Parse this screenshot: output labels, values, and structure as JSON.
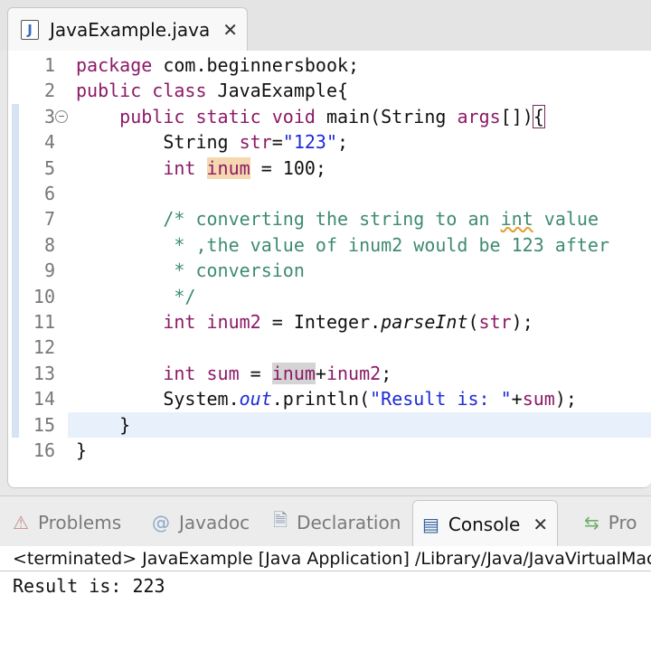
{
  "editor": {
    "tab": {
      "icon_letter": "J",
      "title": "JavaExample.java",
      "close": "✕"
    },
    "lines": [
      {
        "n": "1",
        "segs": [
          {
            "t": "package",
            "c": "kw"
          },
          {
            "t": " com.beginnersbook;"
          }
        ]
      },
      {
        "n": "2",
        "segs": [
          {
            "t": "public",
            "c": "kw"
          },
          {
            "t": " "
          },
          {
            "t": "class",
            "c": "kw"
          },
          {
            "t": " JavaExample{"
          }
        ]
      },
      {
        "n": "3",
        "fold": "−",
        "segs": [
          {
            "t": "    "
          },
          {
            "t": "public",
            "c": "kw"
          },
          {
            "t": " "
          },
          {
            "t": "static",
            "c": "kw"
          },
          {
            "t": " "
          },
          {
            "t": "void",
            "c": "kw"
          },
          {
            "t": " main(String "
          },
          {
            "t": "args",
            "c": "kw"
          },
          {
            "t": "[])"
          },
          {
            "t": "{",
            "c": "brace-box"
          }
        ]
      },
      {
        "n": "4",
        "segs": [
          {
            "t": "        String "
          },
          {
            "t": "str",
            "c": "kw"
          },
          {
            "t": "="
          },
          {
            "t": "\"123\"",
            "c": "str"
          },
          {
            "t": ";"
          }
        ]
      },
      {
        "n": "5",
        "segs": [
          {
            "t": "        "
          },
          {
            "t": "int",
            "c": "kw"
          },
          {
            "t": " "
          },
          {
            "t": "inum",
            "c": "kw hl-var"
          },
          {
            "t": " = 100;"
          }
        ]
      },
      {
        "n": "6",
        "segs": []
      },
      {
        "n": "7",
        "segs": [
          {
            "t": "        "
          },
          {
            "t": "/* converting the string to an ",
            "c": "cm"
          },
          {
            "t": "int",
            "c": "cm squiggle"
          },
          {
            "t": " value",
            "c": "cm"
          }
        ]
      },
      {
        "n": "8",
        "segs": [
          {
            "t": "         * ,the value of inum2 would be 123 after",
            "c": "cm"
          }
        ]
      },
      {
        "n": "9",
        "segs": [
          {
            "t": "         * conversion",
            "c": "cm"
          }
        ]
      },
      {
        "n": "10",
        "segs": [
          {
            "t": "         */",
            "c": "cm"
          }
        ]
      },
      {
        "n": "11",
        "segs": [
          {
            "t": "        "
          },
          {
            "t": "int",
            "c": "kw"
          },
          {
            "t": " "
          },
          {
            "t": "inum2",
            "c": "kw"
          },
          {
            "t": " = Integer."
          },
          {
            "t": "parseInt",
            "c": "it"
          },
          {
            "t": "("
          },
          {
            "t": "str",
            "c": "kw"
          },
          {
            "t": ");"
          }
        ]
      },
      {
        "n": "12",
        "segs": []
      },
      {
        "n": "13",
        "segs": [
          {
            "t": "        "
          },
          {
            "t": "int",
            "c": "kw"
          },
          {
            "t": " "
          },
          {
            "t": "sum",
            "c": "kw"
          },
          {
            "t": " = "
          },
          {
            "t": "inum",
            "c": "kw hl-occ"
          },
          {
            "t": "+"
          },
          {
            "t": "inum2",
            "c": "kw"
          },
          {
            "t": ";"
          }
        ]
      },
      {
        "n": "14",
        "segs": [
          {
            "t": "        System."
          },
          {
            "t": "out",
            "c": "fld"
          },
          {
            "t": ".println("
          },
          {
            "t": "\"Result is: \"",
            "c": "str"
          },
          {
            "t": "+"
          },
          {
            "t": "sum",
            "c": "kw"
          },
          {
            "t": ");"
          }
        ]
      },
      {
        "n": "15",
        "current": true,
        "segs": [
          {
            "t": "    }"
          }
        ]
      },
      {
        "n": "16",
        "segs": [
          {
            "t": "}"
          }
        ]
      }
    ]
  },
  "panel": {
    "tabs": [
      {
        "id": "problems",
        "label": "Problems",
        "icon": "problems-icon",
        "glyph": "⚠",
        "active": false
      },
      {
        "id": "javadoc",
        "label": "Javadoc",
        "icon": "javadoc-icon",
        "glyph": "@",
        "active": false
      },
      {
        "id": "declaration",
        "label": "Declaration",
        "icon": "declaration-icon",
        "glyph": "🗎",
        "active": false
      },
      {
        "id": "console",
        "label": "Console",
        "icon": "console-icon",
        "glyph": "▤",
        "active": true,
        "close": "✕"
      },
      {
        "id": "progress",
        "label": "Pro",
        "icon": "progress-icon",
        "glyph": "⇆",
        "active": false
      }
    ],
    "console_header": "<terminated> JavaExample [Java Application] /Library/Java/JavaVirtualMachines",
    "output": "Result is: 223"
  }
}
